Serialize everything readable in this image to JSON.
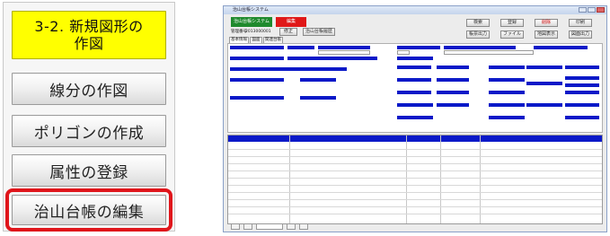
{
  "menu": {
    "title_line1": "3-2. 新規図形の",
    "title_line2": "作図",
    "items": [
      {
        "label": "線分の作図"
      },
      {
        "label": "ポリゴンの作成"
      },
      {
        "label": "属性の登録"
      },
      {
        "label": "治山台帳の編集"
      }
    ],
    "colors": {
      "active": "#ffff00",
      "highlight": "#e0151b"
    }
  },
  "window": {
    "title": "治山台帳システム",
    "system_label": "治山台帳システム",
    "mode_label": "編集",
    "record_label": "管理番号",
    "record_value": "2013000001",
    "btn_edit": "修正",
    "btn_history": "治山台帳履歴",
    "toolbar": [
      "検索",
      "登録",
      "削除",
      "印刷",
      "帳票出力",
      "ファイル",
      "地図表示",
      "図面出力"
    ],
    "tabs": [
      "基本情報",
      "図面",
      "関連台帳"
    ],
    "colors": {
      "field_label": "#0a19c8",
      "system": "#1f8a2d",
      "mode": "#e01818"
    }
  }
}
